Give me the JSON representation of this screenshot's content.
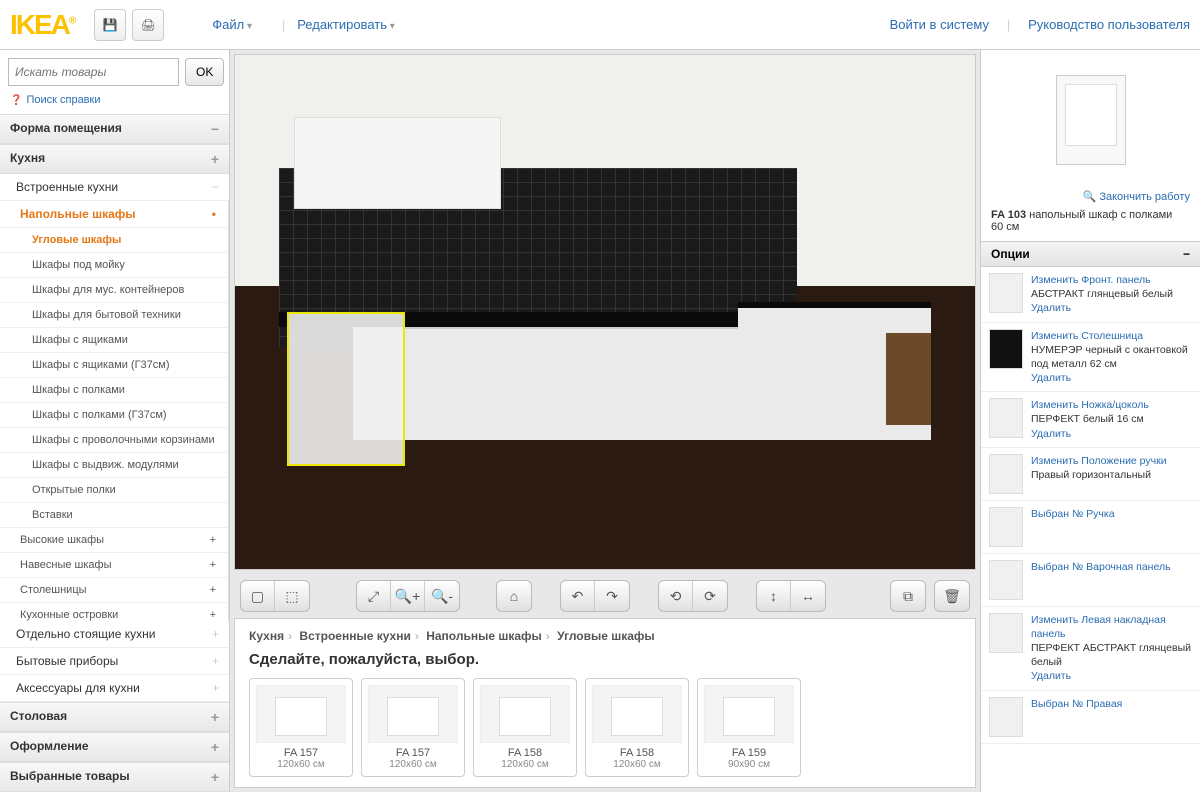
{
  "header": {
    "logo": "IKEA",
    "menu_file": "Файл",
    "menu_edit": "Редактировать",
    "login": "Войти в систему",
    "guide": "Руководство пользователя"
  },
  "search": {
    "placeholder": "Искать товары",
    "ok": "OK",
    "help": "Поиск справки"
  },
  "sidebar": {
    "sections": [
      {
        "title": "Форма помещения",
        "pm": "−"
      },
      {
        "title": "Кухня",
        "pm": "+"
      }
    ],
    "sub": {
      "title": "Встроенные кухни",
      "pm": "−"
    },
    "l1": "Напольные шкафы",
    "items": [
      "Угловые шкафы",
      "Шкафы под мойку",
      "Шкафы для мус. контейнеров",
      "Шкафы для бытовой техники",
      "Шкафы с ящиками",
      "Шкафы с ящиками (Г37см)",
      "Шкафы с полками",
      "Шкафы с полками (Г37см)",
      "Шкафы с проволочными корзинами",
      "Шкафы с выдвиж. модулями",
      "Открытые полки",
      "Вставки"
    ],
    "siblings": [
      "Высокие шкафы",
      "Навесные шкафы",
      "Столешницы",
      "Кухонные островки"
    ],
    "outer": [
      "Отдельно стоящие кухни",
      "Бытовые приборы",
      "Аксессуары для кухни"
    ],
    "bottom": [
      "Столовая",
      "Оформление",
      "Выбранные товары"
    ]
  },
  "breadcrumb": [
    "Кухня",
    "Встроенные кухни",
    "Напольные шкафы",
    "Угловые шкафы"
  ],
  "prompt": "Сделайте, пожалуйста, выбор.",
  "cards": [
    {
      "name": "FA 157",
      "dim": "120x60 см"
    },
    {
      "name": "FA 157",
      "dim": "120x60 см"
    },
    {
      "name": "FA 158",
      "dim": "120x60 см"
    },
    {
      "name": "FA 158",
      "dim": "120x60 см"
    },
    {
      "name": "FA 159",
      "dim": "90x90 см"
    }
  ],
  "right": {
    "finish": "Закончить работу",
    "prod_code": "FA 103",
    "prod_desc": "напольный шкаф с полками",
    "prod_dim": "60 см",
    "options_title": "Опции",
    "options": [
      {
        "link": "Изменить Фронт. панель",
        "desc": "АБСТРАКТ глянцевый белый",
        "del": "Удалить",
        "thumb": ""
      },
      {
        "link": "Изменить Столешница",
        "desc": "НУМЕРЭР черный с окантовкой под металл 62 см",
        "del": "Удалить",
        "thumb": "black"
      },
      {
        "link": "Изменить Ножка/цоколь",
        "desc": "ПЕРФЕКТ белый 16 см",
        "del": "Удалить",
        "thumb": ""
      },
      {
        "link": "Изменить Положение ручки",
        "desc": "Правый горизонтальный",
        "del": "",
        "thumb": ""
      },
      {
        "link": "Выбран № Ручка",
        "desc": "",
        "del": "",
        "thumb": ""
      },
      {
        "link": "Выбран № Варочная панель",
        "desc": "",
        "del": "",
        "thumb": ""
      },
      {
        "link": "Изменить Левая накладная панель",
        "desc": "ПЕРФЕКТ АБСТРАКТ глянцевый белый",
        "del": "Удалить",
        "thumb": ""
      },
      {
        "link": "Выбран № Правая",
        "desc": "",
        "del": "",
        "thumb": ""
      }
    ]
  }
}
